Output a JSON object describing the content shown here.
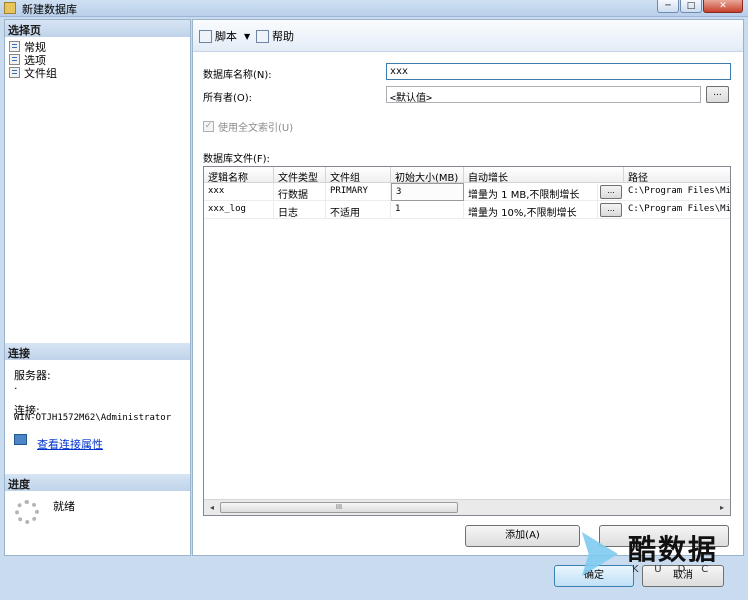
{
  "window": {
    "title": "新建数据库",
    "min_glyph": "─",
    "max_glyph": "□",
    "close_glyph": "✕"
  },
  "left_panel": {
    "select_page": {
      "header": "选择页",
      "items": [
        {
          "label": "常规",
          "icon": "page-icon"
        },
        {
          "label": "选项",
          "icon": "page-icon"
        },
        {
          "label": "文件组",
          "icon": "page-icon"
        }
      ]
    },
    "connection": {
      "header": "连接",
      "server_label": "服务器:",
      "server_value": ".",
      "connection_label": "连接:",
      "connection_value": "WIN-OTJH1572M62\\Administrator",
      "view_properties_link": "查看连接属性"
    },
    "progress": {
      "header": "进度",
      "status": "就绪"
    }
  },
  "toolbar": {
    "script_label": "脚本",
    "script_dropdown_glyph": "▼",
    "help_label": "帮助"
  },
  "form": {
    "db_name_label": "数据库名称(N):",
    "db_name_value": "xxx",
    "owner_label": "所有者(O):",
    "owner_value": "<默认值>",
    "browse_glyph": "...",
    "fulltext_label": "使用全文索引(U)",
    "fulltext_checked": true,
    "check_glyph": "✓",
    "db_files_label": "数据库文件(F):"
  },
  "files_grid": {
    "columns": [
      "逻辑名称",
      "文件类型",
      "文件组",
      "初始大小(MB)",
      "自动增长",
      "路径"
    ],
    "rows": [
      {
        "logical_name": "xxx",
        "file_type": "行数据",
        "filegroup": "PRIMARY",
        "initial_size": "3",
        "autogrowth": "增量为 1 MB,不限制增长",
        "path": "C:\\Program Files\\Mic"
      },
      {
        "logical_name": "xxx_log",
        "file_type": "日志",
        "filegroup": "不适用",
        "initial_size": "1",
        "autogrowth": "增量为 10%,不限制增长",
        "path": "C:\\Program Files\\Mic"
      }
    ],
    "cell_button_glyph": "...",
    "scroll_left_glyph": "◂",
    "scroll_right_glyph": "▸",
    "scroll_thumb_glyph": "III"
  },
  "buttons": {
    "add": "添加(A)",
    "ok": "确定",
    "cancel": "取消"
  },
  "watermark": {
    "text": "酷数据",
    "sub": "KUDC"
  },
  "colors": {
    "window_bg": "#c9dbef",
    "section_header": "#bfd3ea",
    "link": "#0033cc",
    "watermark_accent": "#7ecbf0"
  }
}
